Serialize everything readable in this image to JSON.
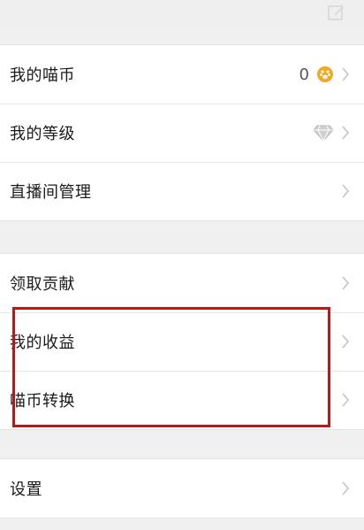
{
  "groups": [
    {
      "items": [
        {
          "label": "我的喵币",
          "value": "0",
          "icon": "coin-icon"
        },
        {
          "label": "我的等级",
          "icon": "diamond-icon"
        },
        {
          "label": "直播间管理"
        }
      ]
    },
    {
      "items": [
        {
          "label": "领取贡献"
        },
        {
          "label": "我的收益"
        },
        {
          "label": "喵币转换"
        }
      ]
    },
    {
      "items": [
        {
          "label": "设置"
        }
      ]
    }
  ],
  "colors": {
    "coin": "#f5a623",
    "highlight_border": "#b31b1b",
    "chevron": "#c3c3c3",
    "diamond": "#b8b8b8"
  }
}
